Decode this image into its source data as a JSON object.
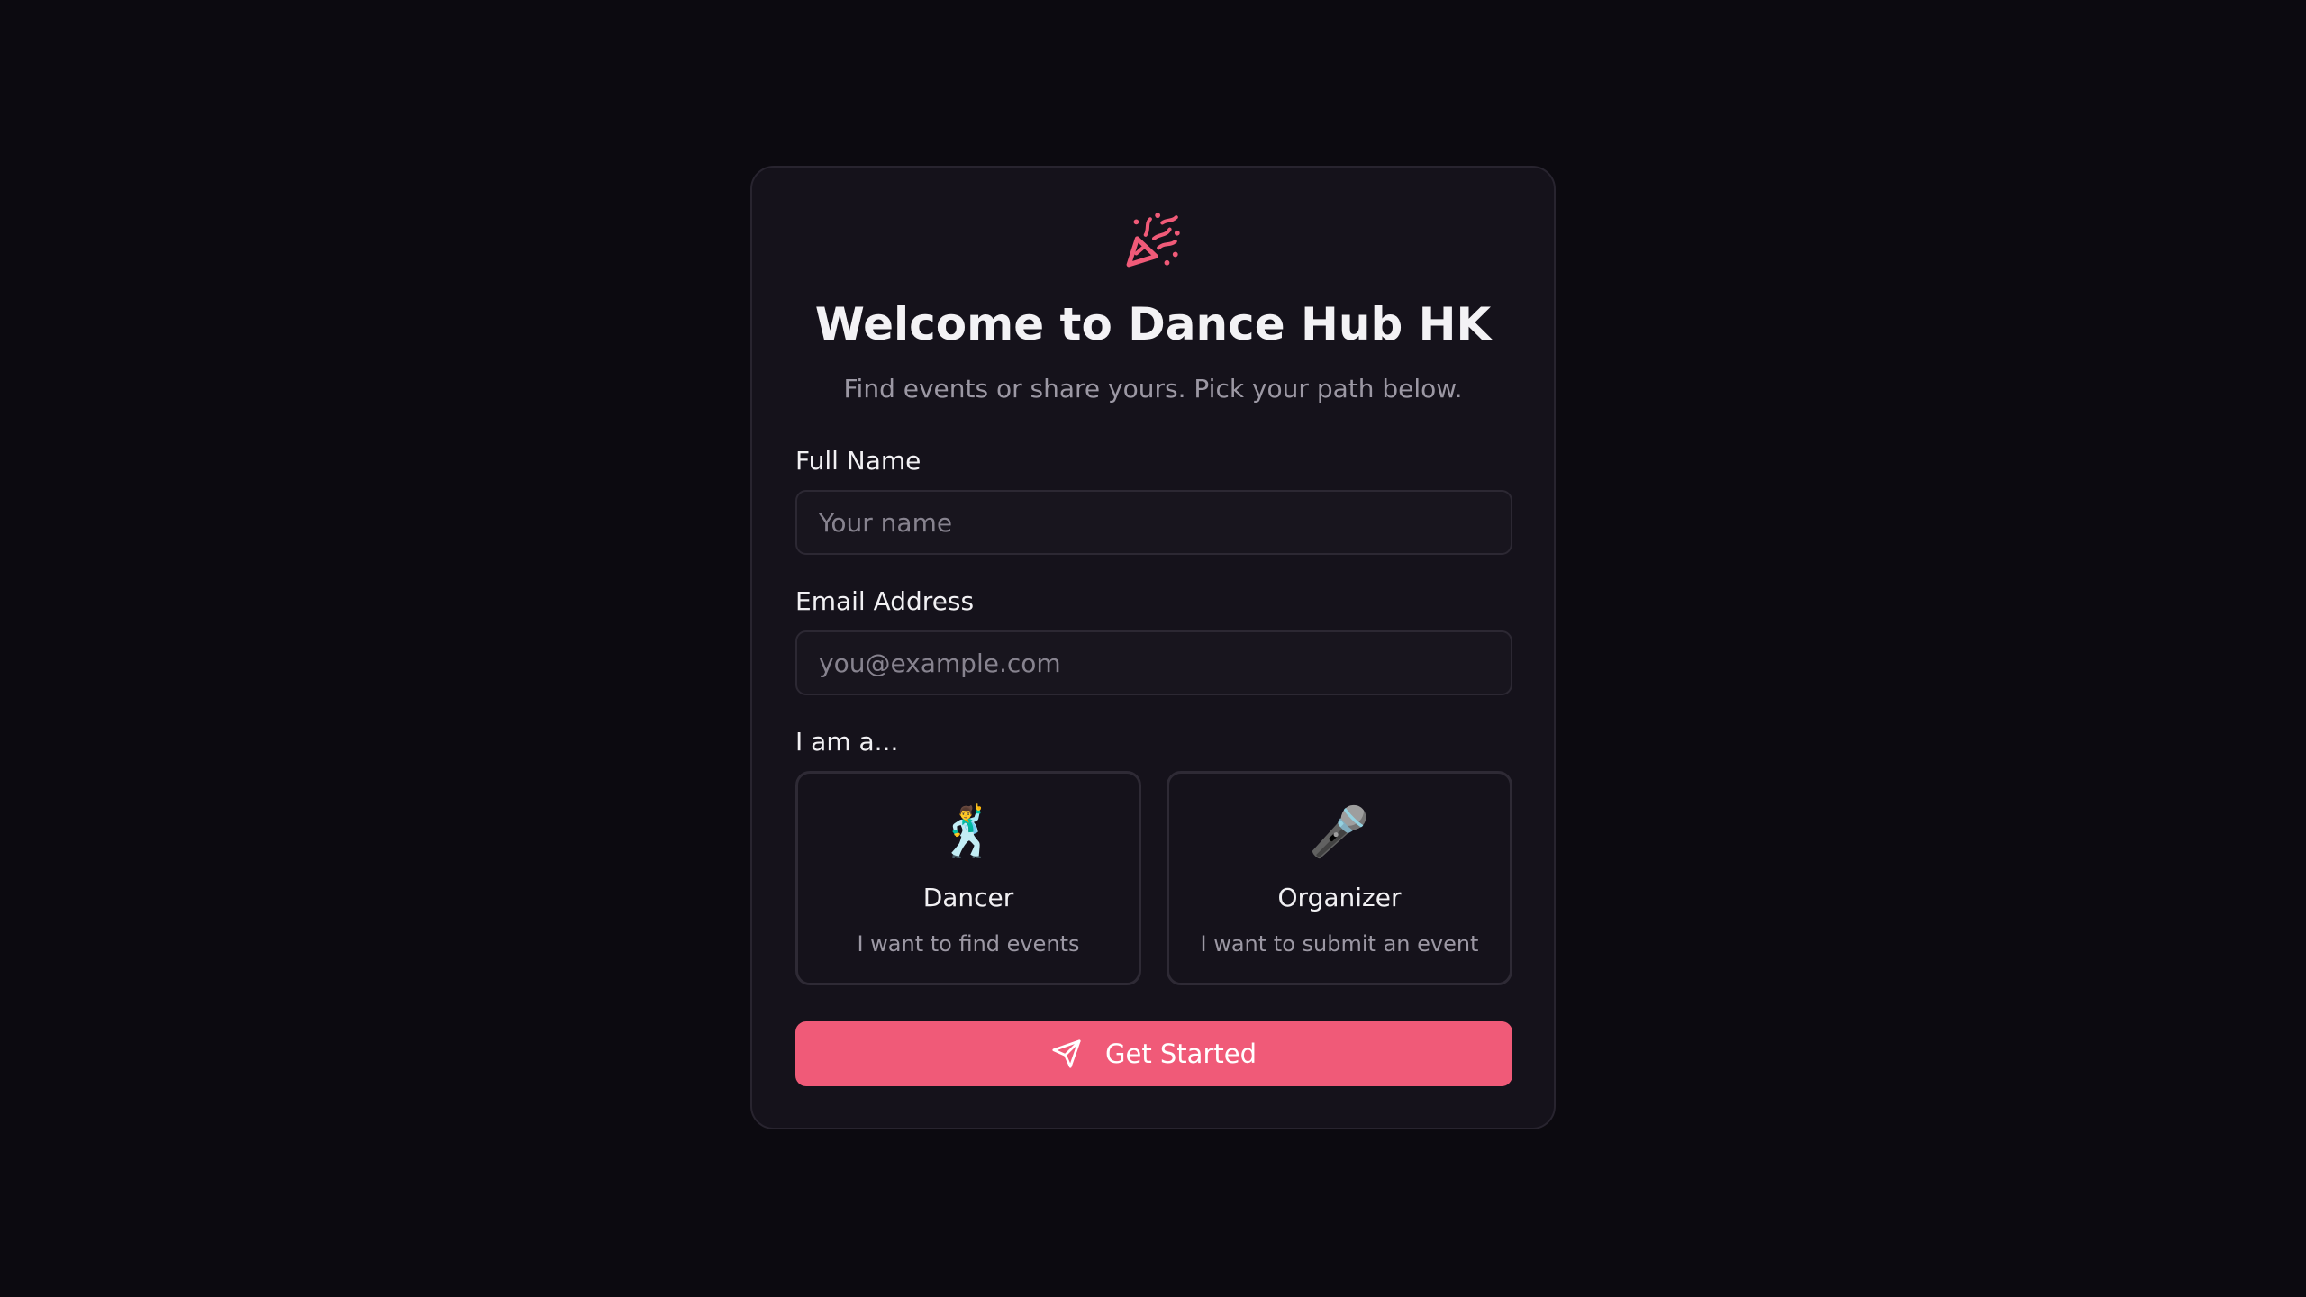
{
  "header": {
    "logo_icon": "party-popper-icon",
    "title": "Welcome to Dance Hub HK",
    "subtitle": "Find events or share yours. Pick your path below."
  },
  "form": {
    "name": {
      "label": "Full Name",
      "value": "",
      "placeholder": "Your name"
    },
    "email": {
      "label": "Email Address",
      "value": "",
      "placeholder": "you@example.com"
    },
    "role": {
      "label": "I am a...",
      "options": [
        {
          "icon": "dancer-icon",
          "emoji": "🕺",
          "title": "Dancer",
          "description": "I want to find events"
        },
        {
          "icon": "microphone-icon",
          "emoji": "🎤",
          "title": "Organizer",
          "description": "I want to submit an event"
        }
      ]
    },
    "submit": {
      "icon": "send-icon",
      "label": "Get Started"
    }
  },
  "colors": {
    "background": "#0c0a10",
    "card": "#15121b",
    "accent": "#f05a78",
    "text_muted": "#9c98a4"
  }
}
